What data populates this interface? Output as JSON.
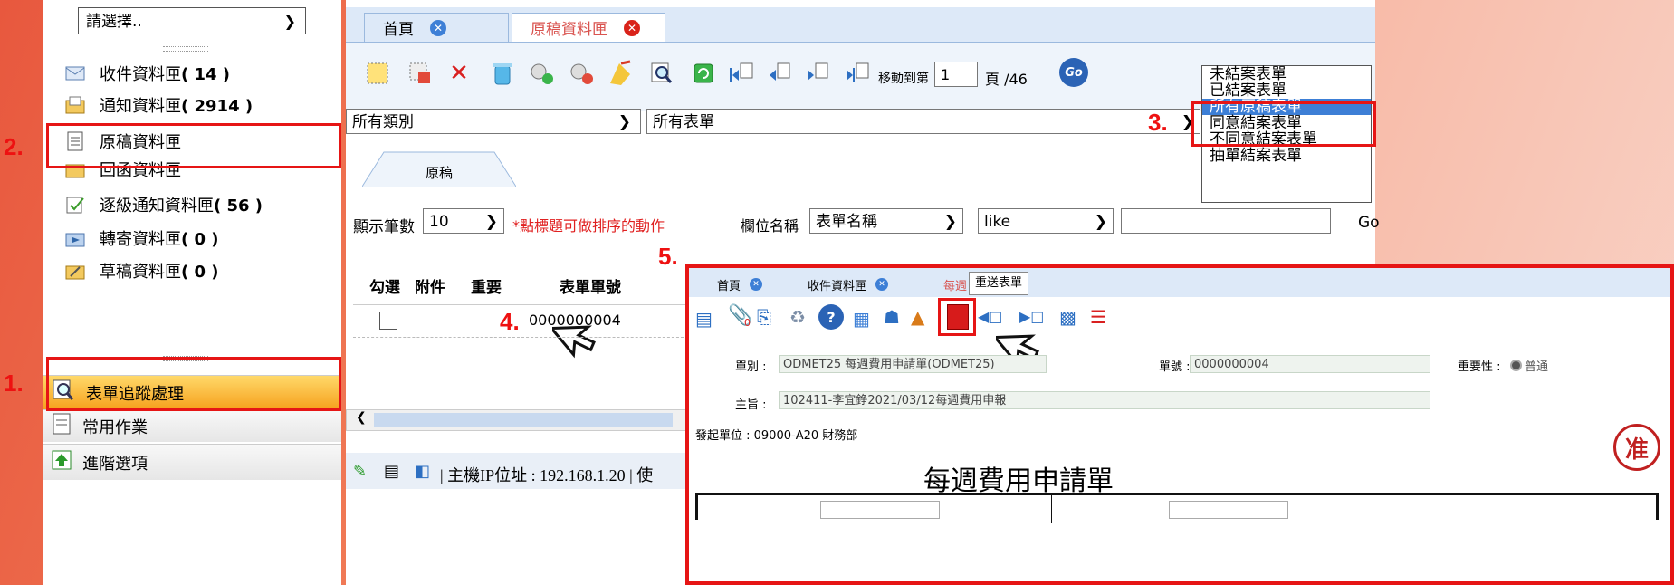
{
  "sidebar": {
    "select_value": "請選擇..",
    "mailboxes": [
      {
        "label": "收件資料匣",
        "count": "( 14 )"
      },
      {
        "label": "通知資料匣",
        "count": "( 2914 )"
      },
      {
        "label": "原稿資料匣",
        "count": ""
      },
      {
        "label": "回函資料匣",
        "count": ""
      },
      {
        "label": "逐級通知資料匣",
        "count": "( 56 )"
      },
      {
        "label": "轉寄資料匣",
        "count": "( 0 )"
      },
      {
        "label": "草稿資料匣",
        "count": "( 0 )"
      }
    ],
    "bottom_items": [
      "表單追蹤處理",
      "常用作業",
      "進階選項"
    ]
  },
  "steps": {
    "s1": "1.",
    "s2": "2.",
    "s3": "3.",
    "s4": "4.",
    "s5": "5."
  },
  "tabs": {
    "home": "首頁",
    "drafts": "原稿資料匣"
  },
  "toolbar": {
    "goto_label": "移動到第",
    "page_value": "1",
    "page_suffix": "頁 /46",
    "go_label": "Go"
  },
  "filters": {
    "category": "所有類別",
    "form": "所有表單",
    "inner_tab": "原稿"
  },
  "listbox": {
    "options": [
      "未結案表單",
      "已結案表單",
      "所有原稿表單",
      "同意結案表單",
      "不同意結案表單",
      "抽單結案表單"
    ],
    "selected_index": 2
  },
  "search": {
    "show_count_label": "顯示筆數",
    "show_count_value": "10",
    "sort_hint": "*點標題可做排序的動作",
    "field_label": "欄位名稱",
    "field_value": "表單名稱",
    "op_value": "like",
    "go_label": "Go"
  },
  "grid": {
    "headers": [
      "勾選",
      "附件",
      "重要",
      "表單單號"
    ],
    "row_number": "0000000004"
  },
  "status": {
    "ip_text": "| 主機IP位址 : 192.168.1.20 | 使"
  },
  "popup": {
    "tabs": [
      "首頁",
      "收件資料匣",
      "每週"
    ],
    "tooltip": "重送表單",
    "kind_label": "單別 :",
    "kind_value": "ODMET25 每週費用申請單(ODMET25)",
    "number_label": "單號 :",
    "number_value": "0000000004",
    "importance_label": "重要性 :",
    "importance_value": "普通",
    "subject_label": "主旨 :",
    "subject_value": "102411-李宜錚2021/03/12每週費用申報",
    "dept_text": "發起單位 : 09000-A20 財務部",
    "form_title": "每週費用申請單",
    "stamp": "准",
    "attach_count": "0"
  },
  "colors": {
    "accent_red": "#e61515",
    "highlight_blue": "#3d7fd6",
    "sort_hint_red": "#e02020"
  }
}
